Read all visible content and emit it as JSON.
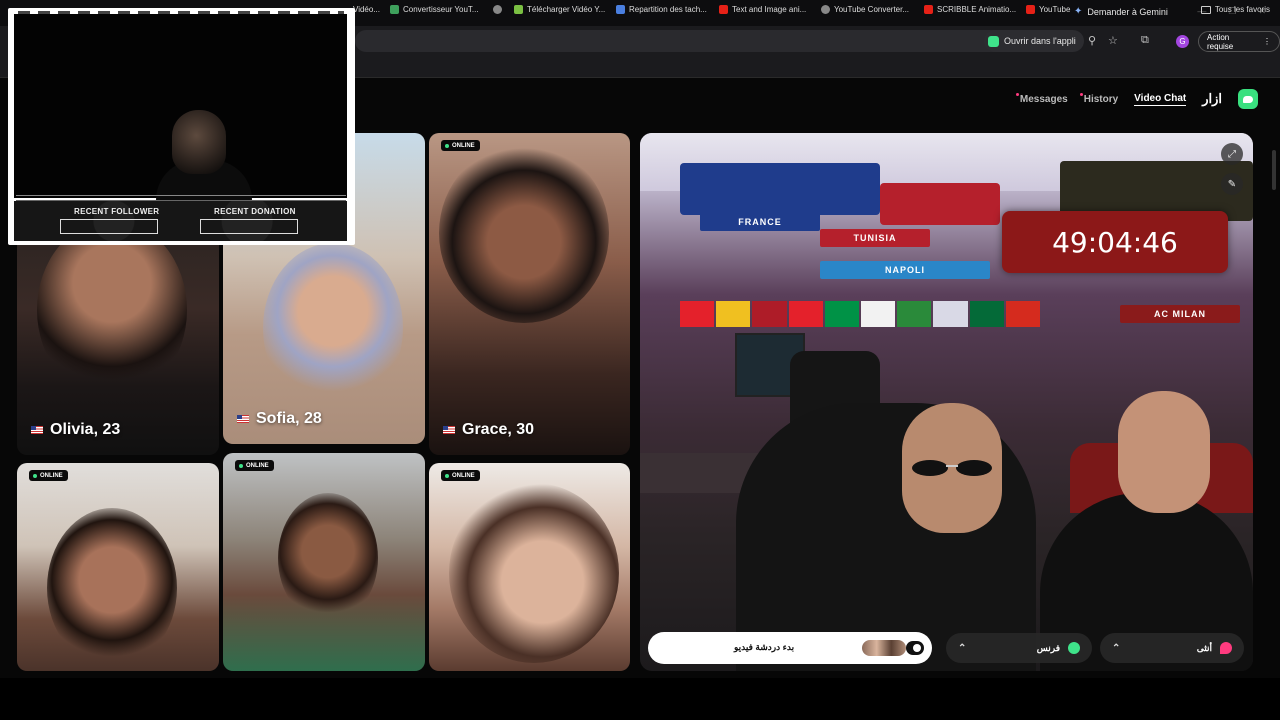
{
  "system": {
    "gemini_label": "Demander à Gemini"
  },
  "toolbar": {
    "open_app_label": "Ouvrir dans l'appli",
    "action_required_label": "Action requise",
    "avatar_letter": "G"
  },
  "bookmarks": {
    "items": [
      {
        "label": "Vidéo...",
        "icon": "bookmark-icon"
      },
      {
        "label": "Convertisseur YouT...",
        "icon": "convert-icon"
      },
      {
        "label": "",
        "icon": "globe-icon"
      },
      {
        "label": "Télécharger Vidéo Y...",
        "icon": "download-icon"
      },
      {
        "label": "Repartition des tach...",
        "icon": "doc-icon"
      },
      {
        "label": "Text and Image ani...",
        "icon": "youtube-icon"
      },
      {
        "label": "YouTube Converter...",
        "icon": "globe-icon"
      },
      {
        "label": "SCRIBBLE Animatio...",
        "icon": "youtube-icon"
      },
      {
        "label": "YouTube",
        "icon": "youtube-icon"
      }
    ],
    "all_label": "Tous les favoris"
  },
  "site_nav": {
    "messages": "Messages",
    "history": "History",
    "video_chat": "Video Chat",
    "brand": "ازار",
    "active": "Video Chat"
  },
  "tiles": [
    {
      "name": "Olivia, 23",
      "online": false,
      "country": "US"
    },
    {
      "name": "Sofia, 28",
      "online": false,
      "country": "US"
    },
    {
      "name": "Grace, 30",
      "online": true,
      "country": "US"
    },
    {
      "name": "",
      "online": true
    },
    {
      "name": "",
      "online": true
    },
    {
      "name": "",
      "online": true
    }
  ],
  "online_label": "ONLINE",
  "stream": {
    "timer": "49:04:46",
    "banners": [
      "FRANCE",
      "TUNISIA",
      "NAPOLI",
      "AC MILAN"
    ]
  },
  "controls": {
    "start_label": "بدء دردشة فيديو",
    "country_label": "فرنس",
    "gender_label": "أنثى"
  },
  "overlay": {
    "recent_follower_label": "RECENT FOLLOWER",
    "recent_donation_label": "RECENT DONATION"
  },
  "colors": {
    "brand_accent": "#39e07f",
    "timer_bg": "#8c1818",
    "online_dot": "#3fe38a"
  }
}
